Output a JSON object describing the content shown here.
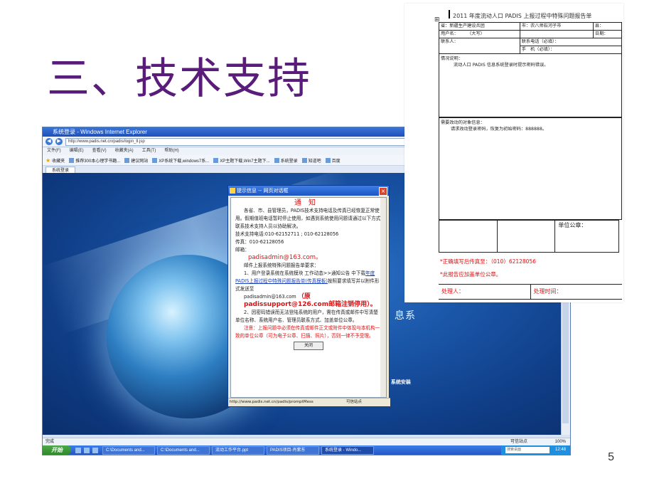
{
  "slide": {
    "title": "三、技术支持",
    "page_number": "5"
  },
  "browser": {
    "window_title": "系统登录 - Windows Internet Explorer",
    "url": "http://www.padis.net.cn/padis/login_tl.jsp",
    "menu": [
      "文件(F)",
      "编辑(E)",
      "查看(V)",
      "收藏夹(A)",
      "工具(T)",
      "帮助(H)"
    ],
    "favorites_label": "收藏夹",
    "favorites": [
      "推荐300本心理学书籍...",
      "建议网站",
      "XP系统下载,windows7系...",
      "XP主题下载,Win7主题下...",
      "系统登录",
      "知道吧",
      "百度"
    ],
    "tab_label": "系统登录",
    "page_text_brand": "息系",
    "page_links": "帮助 | 系统安装",
    "status_left": "完成",
    "status_zone": "可信站点",
    "zoom": "100%"
  },
  "taskbar": {
    "start": "开始",
    "items": [
      "C:\\Documents and...",
      "C:\\Documents and...",
      "流动工作平台.ppt",
      "PADIS项目-肖紫东",
      "系统登录 - Windo..."
    ],
    "search_placeholder": "搜索桌面",
    "clock": "12:48"
  },
  "dialog": {
    "title": "提示信息 -- 网页对话框",
    "notice_title": "通知",
    "para1": "各省、市、县管理员，PADIS技术支持电话及传真已经恢复正常使用。假期值班电话暂时停止使用，如遇到系统使用问题请通过以下方式联系技术支持人员以协助解决。",
    "support_phone": "技术支持电话:010-62152711 ; 010-62128056",
    "fax": "传真：010-62128056",
    "email_label": "邮箱：",
    "email": "padisadmin@163.com。",
    "report_intro": "邮件上报系统特殊问题报告单要求：",
    "step1_before": "1、用户登录系统在系统模块 工作动态>>通知公告 中下载",
    "step1_link": "年度PADIS上报过程中特殊问题报告单(传真模板)",
    "step1_after": "按照要求填写并以附件形式发送至",
    "step1_email": "padisadmin@163.com",
    "old_email_note": "（原padissupport@126.com邮箱注销停用）。",
    "step2": "2、因密码错误而无法登陆系统的用户，需在传真或邮件中写清楚单位名称、系统用户名、管理员联系方式、加盖单位公章。",
    "note_red": "注意：上报问题中必须在传真或邮件正文或附件中体现与本机构一致的单位公章（可为电子公章、扫描、照片），否则一律不予受理。",
    "close_button": "关闭",
    "status_url": "http://www.padis.net.cn/padis/promptMess",
    "status_zone": "可信站点"
  },
  "form": {
    "title": "2011 年度流动人口 PADIS 上报过程中特殊问题报告单",
    "province": "省：新疆生产建设兵团",
    "city": "市：农八师石河子市",
    "county": "县：",
    "username": "用户名：　　　（大写）",
    "date": "日期：",
    "contact": "联系人：",
    "phone": "联系电话（必填）：",
    "mobile": "手　机（必填）：",
    "situation_label": "情况说明：",
    "situation_text": "流动人口 PADIS 信息系统登录时提示密码错误。",
    "fix_label": "需要改动的对象信息：",
    "fix_text": "请求改动登录密码，恢复为初始密码：888888。",
    "stamp_label": "单位公章：",
    "note1": "*正确填写后传真至：（010）62128056",
    "note2": "*此报告应加盖单位公章。",
    "handler": "处理人：",
    "handle_time": "处理时间："
  }
}
